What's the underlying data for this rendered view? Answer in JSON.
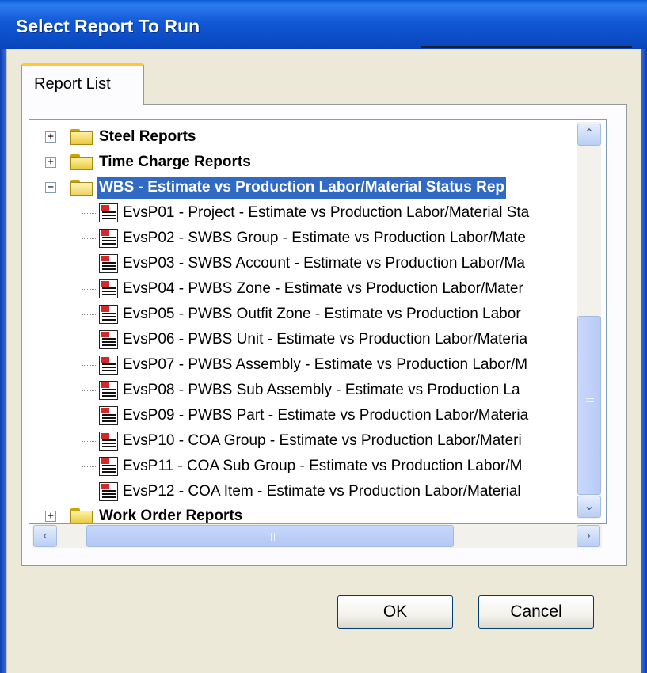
{
  "window": {
    "title": "Select Report To Run"
  },
  "tabs": [
    {
      "label": "Report List"
    }
  ],
  "tree": {
    "items": [
      {
        "label": "Steel Reports",
        "kind": "folder",
        "expander": "+"
      },
      {
        "label": "Time Charge Reports",
        "kind": "folder",
        "expander": "+"
      },
      {
        "label": "WBS - Estimate vs Production Labor/Material Status Rep",
        "kind": "folder",
        "expander": "−",
        "selected": true
      },
      {
        "label": "EvsP01 - Project - Estimate vs Production Labor/Material Sta",
        "kind": "report"
      },
      {
        "label": "EvsP02 - SWBS Group - Estimate vs Production Labor/Mate",
        "kind": "report"
      },
      {
        "label": "EvsP03 - SWBS Account - Estimate vs Production Labor/Ma",
        "kind": "report"
      },
      {
        "label": "EvsP04 - PWBS Zone - Estimate vs Production Labor/Mater",
        "kind": "report"
      },
      {
        "label": "EvsP05 - PWBS Outfit Zone - Estimate vs Production Labor",
        "kind": "report"
      },
      {
        "label": "EvsP06 - PWBS Unit - Estimate vs Production Labor/Materia",
        "kind": "report"
      },
      {
        "label": "EvsP07 - PWBS Assembly - Estimate vs Production Labor/M",
        "kind": "report"
      },
      {
        "label": "EvsP08 - PWBS Sub Assembly - Estimate vs Production La",
        "kind": "report"
      },
      {
        "label": "EvsP09 - PWBS Part - Estimate vs Production Labor/Materia",
        "kind": "report"
      },
      {
        "label": "EvsP10 - COA Group - Estimate vs Production Labor/Materi",
        "kind": "report"
      },
      {
        "label": "EvsP11 - COA Sub Group - Estimate vs Production Labor/M",
        "kind": "report"
      },
      {
        "label": "EvsP12 - COA Item - Estimate vs Production Labor/Material",
        "kind": "report"
      },
      {
        "label": "Work Order Reports",
        "kind": "folder",
        "expander": "+"
      }
    ]
  },
  "scrollbars": {
    "up_icon": "chevron-up-icon",
    "down_icon": "chevron-down-icon",
    "left_icon": "chevron-left-icon",
    "right_icon": "chevron-right-icon"
  },
  "buttons": {
    "ok_label": "OK",
    "cancel_label": "Cancel"
  },
  "colors": {
    "title_bar": "#0b4cc4",
    "selection": "#316ac5",
    "tab_highlight": "#ffc73c"
  }
}
